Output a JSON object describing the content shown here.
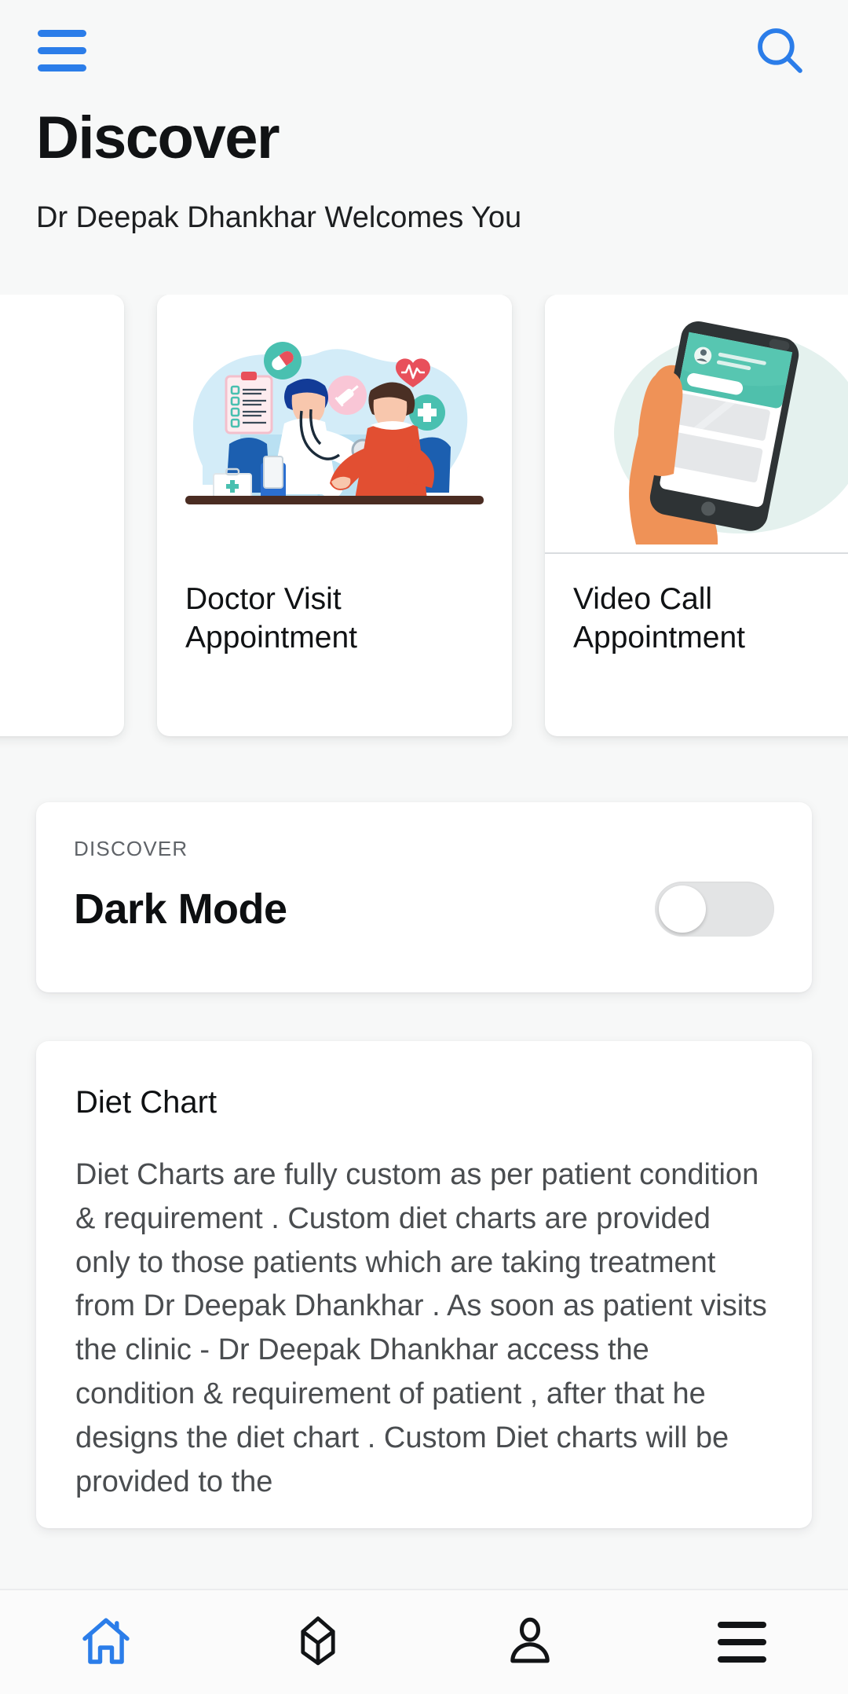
{
  "theme": {
    "accent": "#2b7de9",
    "page_bg": "#f7f8f8",
    "card_bg": "#ffffff",
    "text_primary": "#111315",
    "text_muted": "#4a4d50"
  },
  "topbar": {
    "menu_icon": "hamburger-menu-icon",
    "search_icon": "search-icon"
  },
  "header": {
    "title": "Discover",
    "subtitle": "Dr Deepak Dhankhar Welcomes You"
  },
  "carousel": {
    "cards": [
      {
        "title": "Doctor Visit Appointment",
        "image": "doctor-examining-patient-illustration"
      },
      {
        "title": "Video Call Appointment",
        "image": "hand-holding-phone-illustration"
      }
    ]
  },
  "setting_card": {
    "eyebrow": "DISCOVER",
    "title": "Dark Mode",
    "toggle_state": "off"
  },
  "article_card": {
    "title": "Diet Chart",
    "body": "Diet Charts are fully custom as per patient condition & requirement . Custom diet charts are provided only to those patients which are taking treatment from Dr Deepak Dhankhar . As soon as patient visits the clinic - Dr Deepak Dhankhar access the condition & requirement of patient , after that he designs the diet chart . Custom Diet charts will be provided to the"
  },
  "bottom_nav": {
    "items": [
      {
        "name": "home",
        "icon": "home-icon",
        "active": true
      },
      {
        "name": "products",
        "icon": "box-3d-icon",
        "active": false
      },
      {
        "name": "profile",
        "icon": "person-icon",
        "active": false
      },
      {
        "name": "more",
        "icon": "hamburger-menu-icon",
        "active": false
      }
    ]
  }
}
